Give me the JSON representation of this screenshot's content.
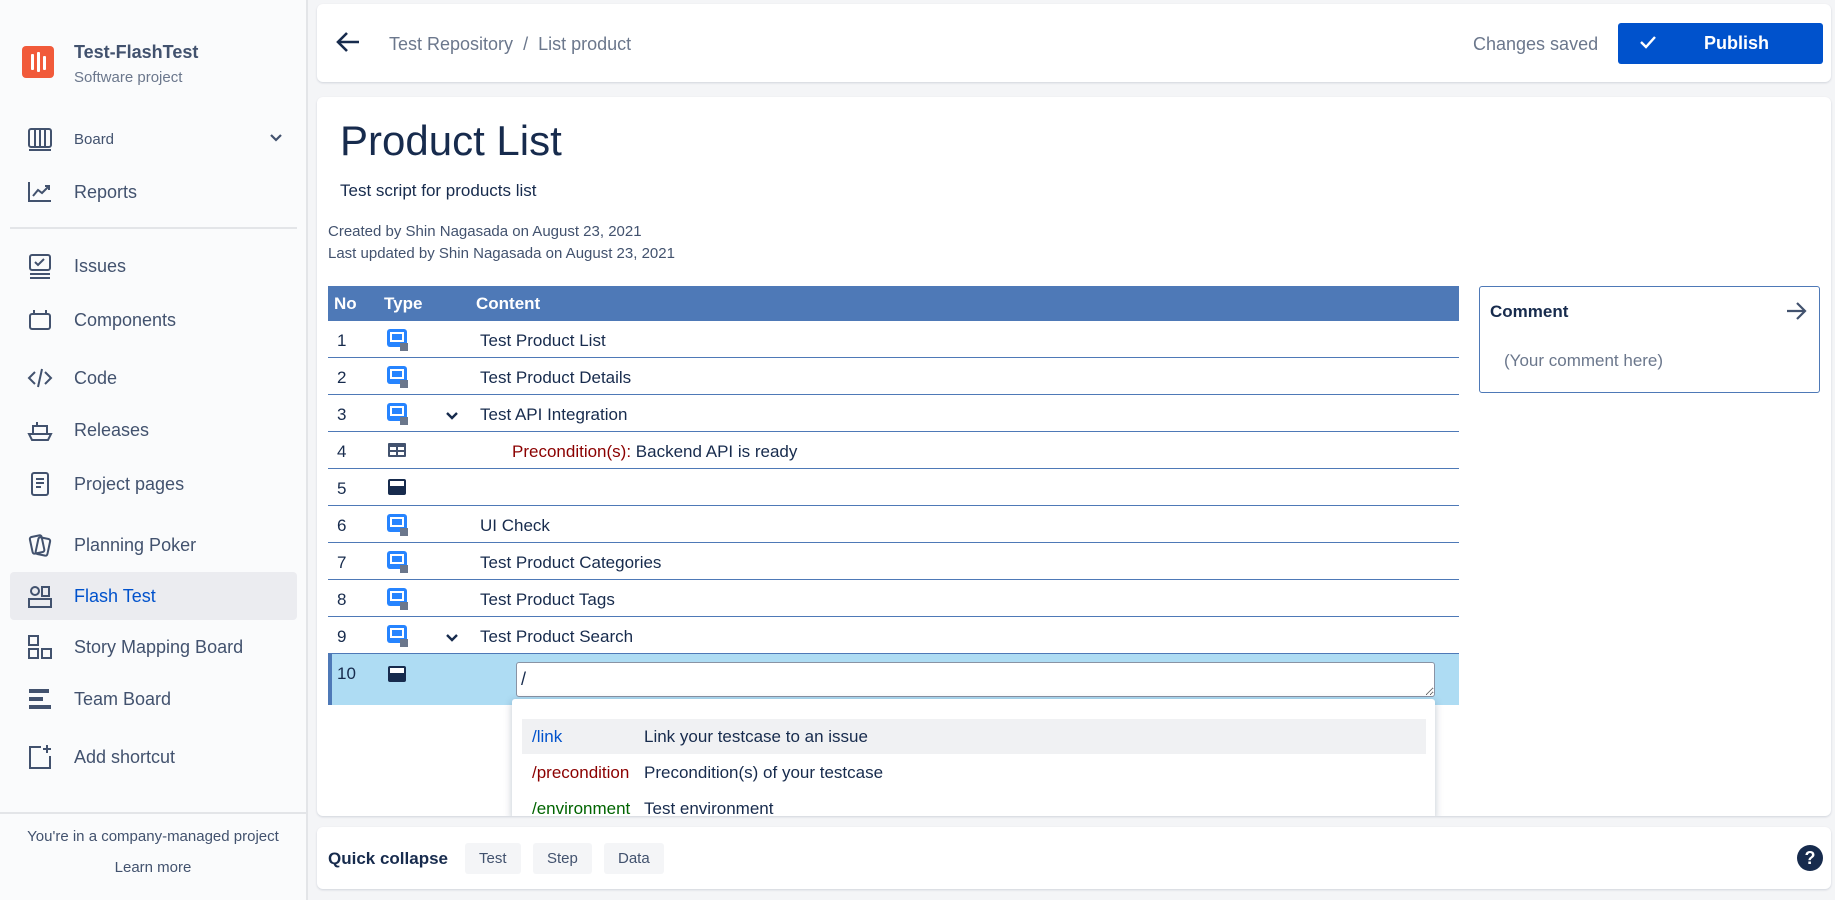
{
  "project": {
    "name": "Test-FlashTest",
    "type": "Software project"
  },
  "sidebar": {
    "items": [
      {
        "label": "Board",
        "icon": "board-icon"
      },
      {
        "label": "Reports",
        "icon": "reports-icon"
      },
      {
        "label": "Issues",
        "icon": "issues-icon"
      },
      {
        "label": "Components",
        "icon": "components-icon"
      },
      {
        "label": "Code",
        "icon": "code-icon"
      },
      {
        "label": "Releases",
        "icon": "releases-icon"
      },
      {
        "label": "Project pages",
        "icon": "project-pages-icon"
      },
      {
        "label": "Planning Poker",
        "icon": "planning-poker-icon"
      },
      {
        "label": "Flash Test",
        "icon": "flash-test-icon",
        "active": true
      },
      {
        "label": "Story Mapping Board",
        "icon": "story-mapping-icon"
      },
      {
        "label": "Team Board",
        "icon": "team-board-icon"
      },
      {
        "label": "Add shortcut",
        "icon": "add-shortcut-icon"
      }
    ],
    "footer_text": "You're in a company-managed project",
    "learn_more": "Learn more"
  },
  "header": {
    "breadcrumb": [
      "Test Repository",
      "List product"
    ],
    "separator": "/",
    "status": "Changes saved",
    "publish_label": "Publish"
  },
  "page": {
    "title": "Product List",
    "description": "Test script for products list",
    "created": "Created by Shin Nagasada on August 23, 2021",
    "updated": "Last updated by Shin Nagasada on August 23, 2021"
  },
  "table": {
    "headers": {
      "no": "No",
      "type": "Type",
      "content": "Content"
    },
    "rows": [
      {
        "no": "1",
        "content": "Test Product List"
      },
      {
        "no": "2",
        "content": "Test Product Details"
      },
      {
        "no": "3",
        "content": "Test API Integration"
      },
      {
        "no": "4",
        "precondition_label": "Precondition(s):",
        "content": "Backend API is ready"
      },
      {
        "no": "5",
        "content": ""
      },
      {
        "no": "6",
        "content": "UI Check"
      },
      {
        "no": "7",
        "content": "Test Product Categories"
      },
      {
        "no": "8",
        "content": "Test Product Tags"
      },
      {
        "no": "9",
        "content": "Test Product Search"
      },
      {
        "no": "10",
        "editor_value": "/"
      }
    ]
  },
  "suggestions": [
    {
      "command": "/link",
      "description": "Link your testcase to an issue",
      "color": "#0052cc"
    },
    {
      "command": "/precondition",
      "description": "Precondition(s) of your testcase",
      "color": "#8b0000"
    },
    {
      "command": "/environment",
      "description": "Test environment",
      "color": "#006400"
    }
  ],
  "comment": {
    "title": "Comment",
    "placeholder": "(Your comment here)"
  },
  "footer": {
    "quick_collapse": "Quick collapse",
    "buttons": [
      "Test",
      "Step",
      "Data"
    ],
    "help": "?"
  },
  "colors": {
    "accent": "#0052cc",
    "table_header": "#4e79b7",
    "selected_row": "#aedcf3",
    "logo": "#f15a3a"
  }
}
